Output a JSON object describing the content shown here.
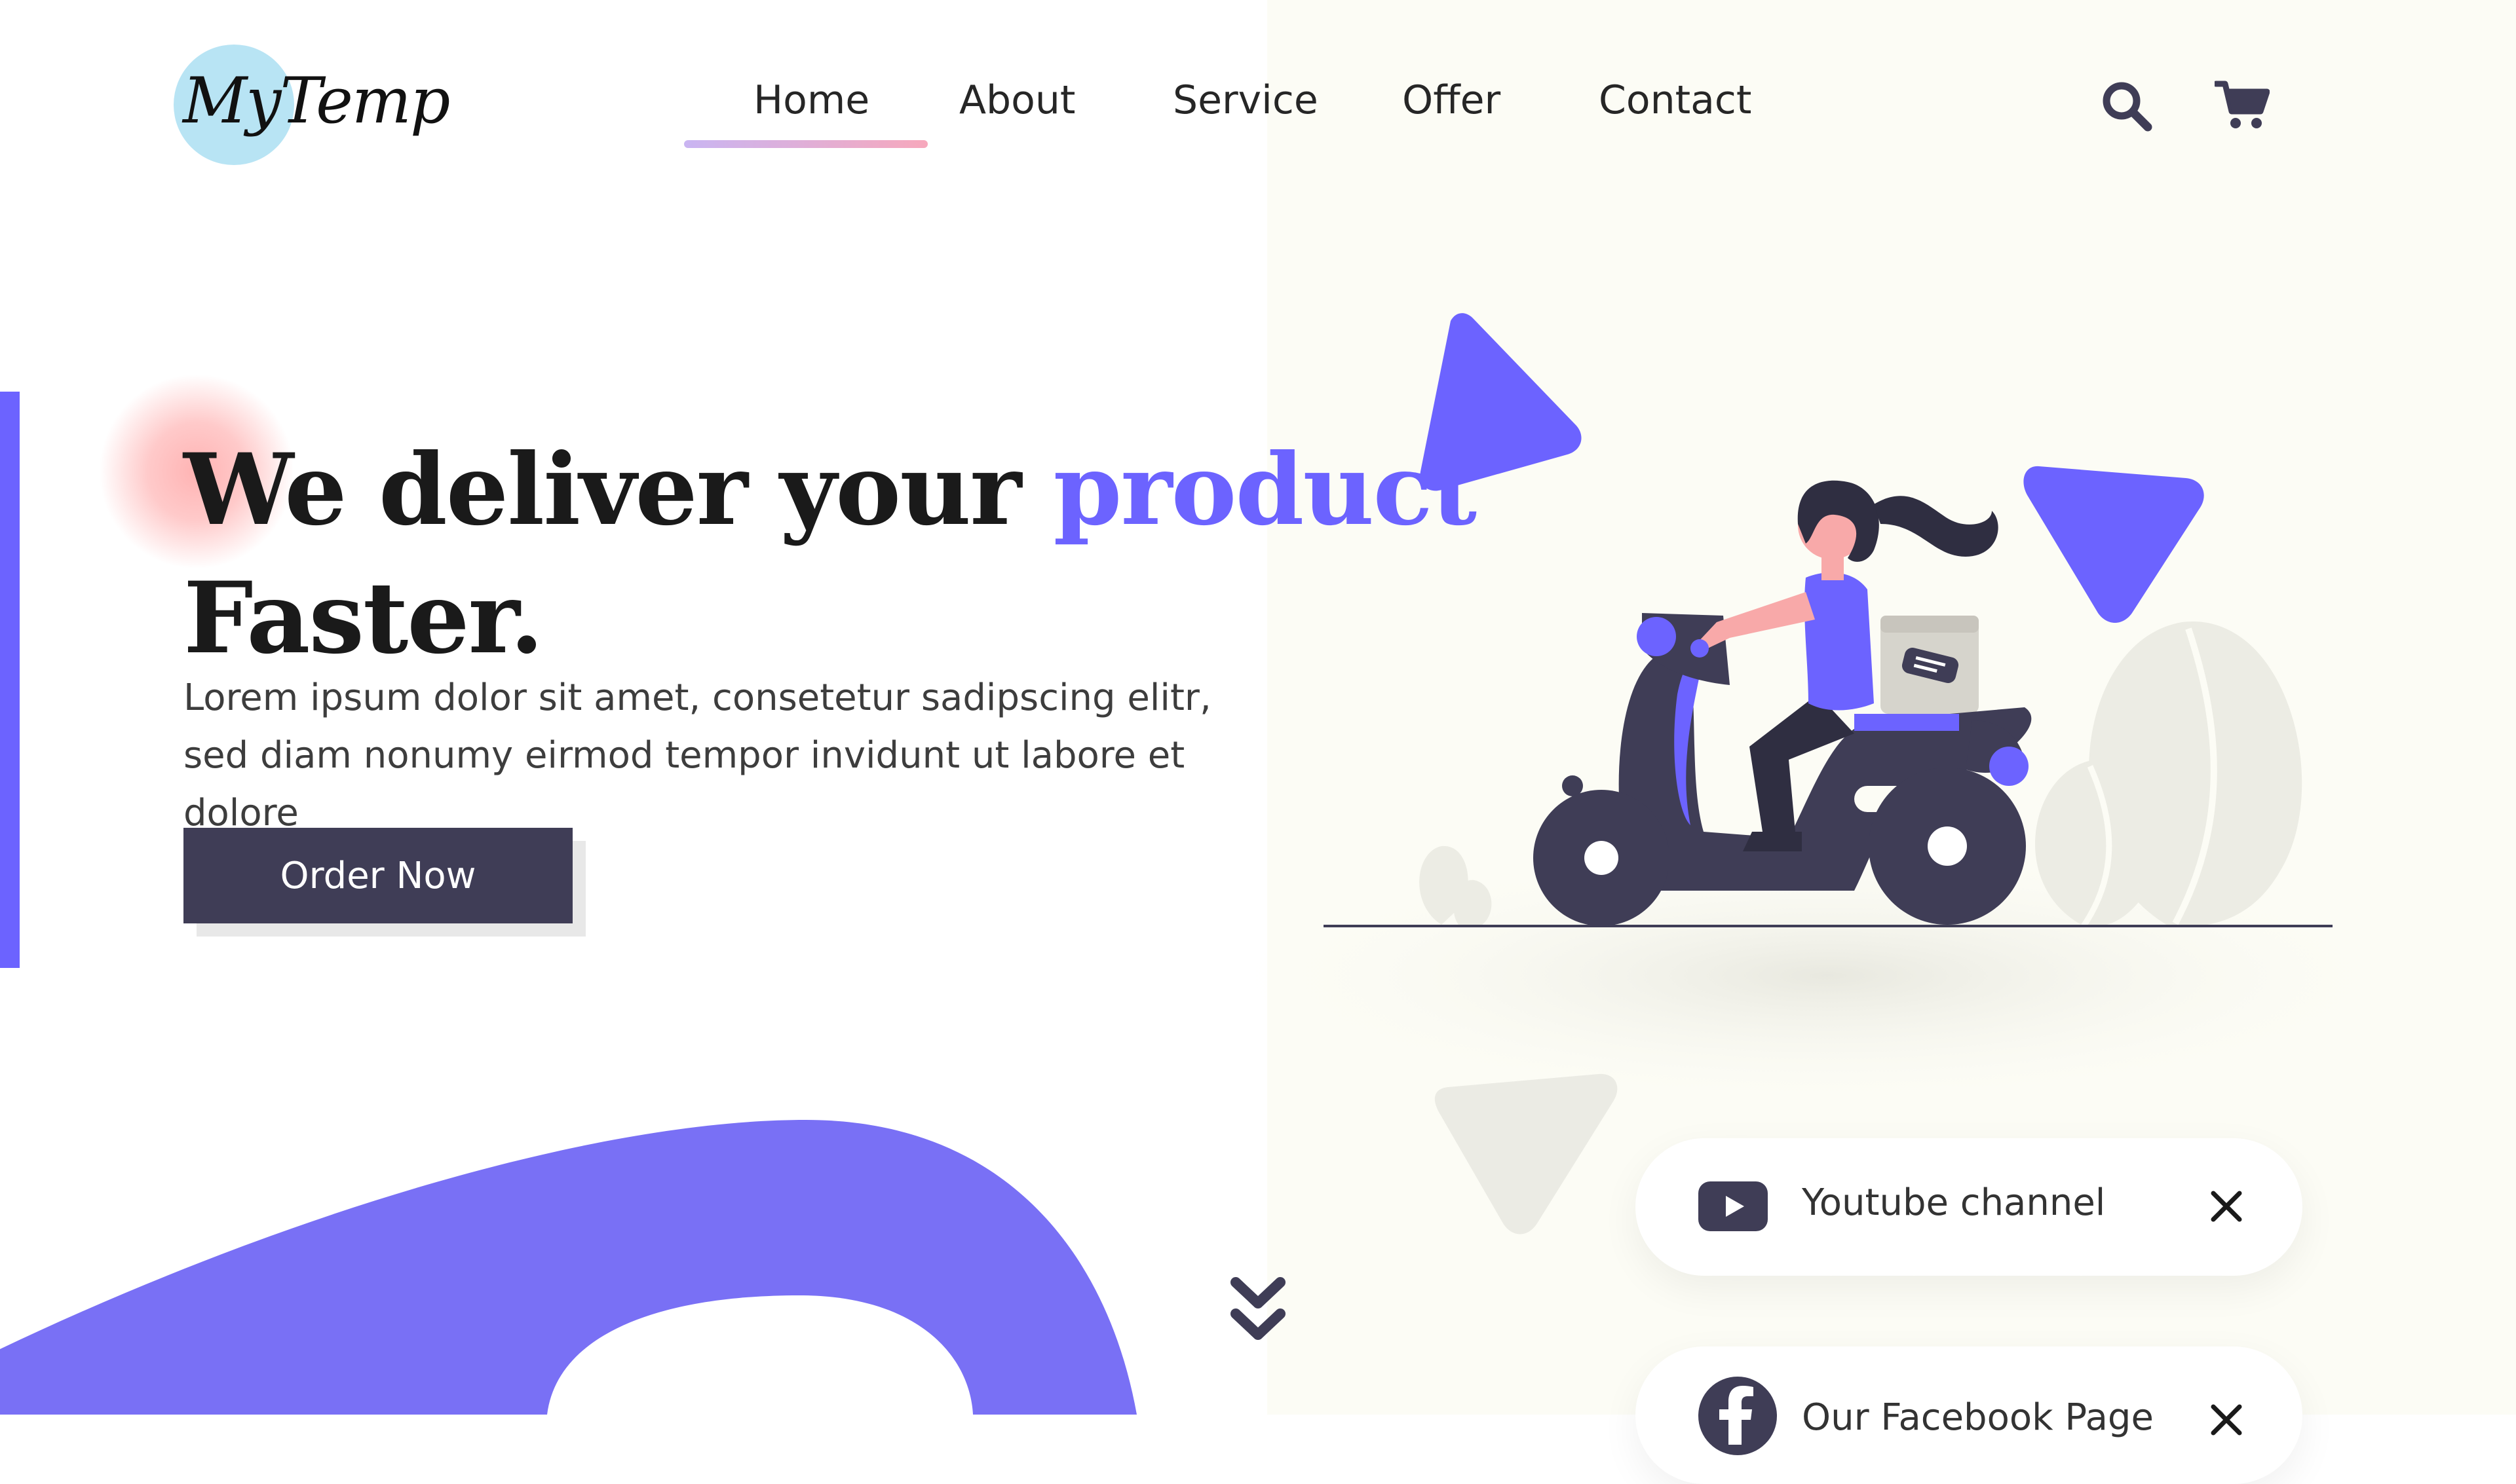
{
  "brand": {
    "logo_text": "MyTemp",
    "accent": "#6c63ff",
    "dark": "#3f3d56"
  },
  "nav": {
    "items": [
      {
        "label": "Home",
        "active": true
      },
      {
        "label": "About"
      },
      {
        "label": "Service"
      },
      {
        "label": "Offer"
      },
      {
        "label": "Contact"
      }
    ],
    "icons": [
      "search-icon",
      "cart-icon"
    ]
  },
  "hero": {
    "headline_part1": "We deliver your ",
    "headline_accent": "product",
    "headline_line2": "Faster.",
    "description": "Lorem ipsum dolor sit amet, consetetur sadipscing elitr, sed diam nonumy eirmod tempor invidunt ut labore et dolore",
    "cta_label": "Order Now"
  },
  "social_cards": [
    {
      "label": "Youtube channel",
      "icon": "youtube-icon"
    },
    {
      "label": "Our Facebook Page",
      "icon": "facebook-icon"
    }
  ]
}
